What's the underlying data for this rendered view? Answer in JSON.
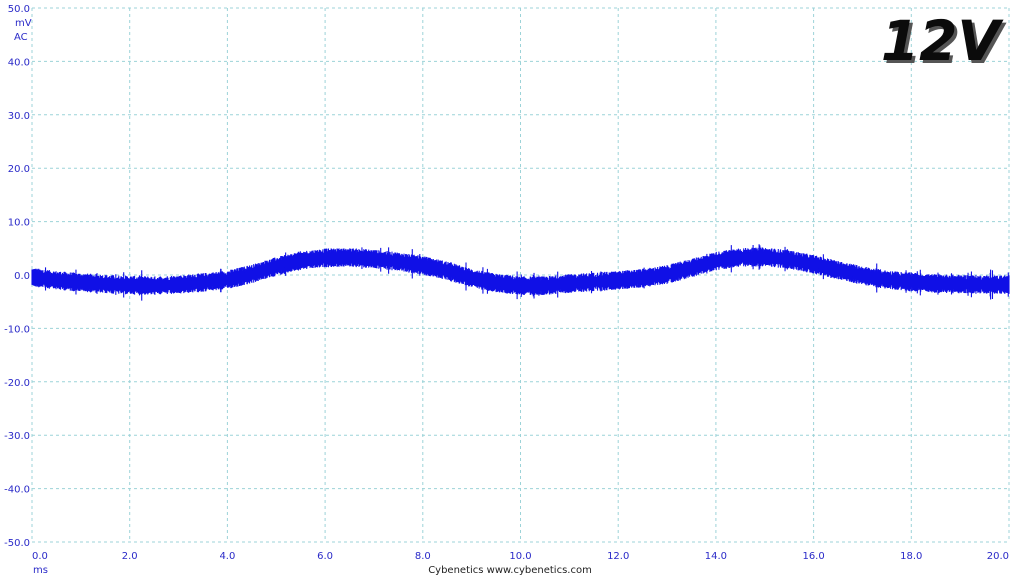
{
  "chart_data": {
    "type": "line",
    "title": "12V",
    "xlabel": "ms",
    "ylabel": "mV",
    "ylabel_coupling": "AC",
    "xlim": [
      0,
      20
    ],
    "ylim": [
      -50,
      50
    ],
    "x_ticks": [
      "0.0",
      "2.0",
      "4.0",
      "6.0",
      "8.0",
      "10.0",
      "12.0",
      "14.0",
      "16.0",
      "18.0",
      "20.0"
    ],
    "y_ticks": [
      "50.0",
      "40.0",
      "30.0",
      "20.0",
      "10.0",
      "0.0",
      "-10.0",
      "-20.0",
      "-30.0",
      "-40.0",
      "-50.0"
    ],
    "grid": true,
    "credit": "Cybenetics  www.cybenetics.com",
    "series": [
      {
        "color": "#1010e6",
        "band_halfwidth_mV": 1.6,
        "x": [
          0.0,
          0.5,
          1.0,
          1.5,
          2.0,
          2.5,
          3.0,
          3.5,
          4.0,
          4.5,
          5.0,
          5.5,
          6.0,
          6.5,
          7.0,
          7.5,
          8.0,
          8.5,
          9.0,
          9.5,
          10.0,
          10.5,
          11.0,
          11.5,
          12.0,
          12.5,
          13.0,
          13.5,
          14.0,
          14.5,
          15.0,
          15.5,
          16.0,
          16.5,
          17.0,
          17.5,
          18.0,
          18.5,
          19.0,
          19.5,
          20.0
        ],
        "center": [
          -0.4,
          -1.0,
          -1.4,
          -1.7,
          -1.9,
          -2.0,
          -1.8,
          -1.4,
          -0.9,
          0.2,
          1.6,
          2.7,
          3.2,
          3.3,
          3.0,
          2.5,
          1.8,
          0.8,
          -0.6,
          -1.5,
          -2.0,
          -2.0,
          -1.6,
          -1.3,
          -1.0,
          -0.6,
          0.1,
          1.3,
          2.6,
          3.3,
          3.4,
          2.9,
          2.0,
          0.9,
          -0.1,
          -0.9,
          -1.3,
          -1.6,
          -1.7,
          -1.8,
          -1.8
        ]
      }
    ]
  }
}
